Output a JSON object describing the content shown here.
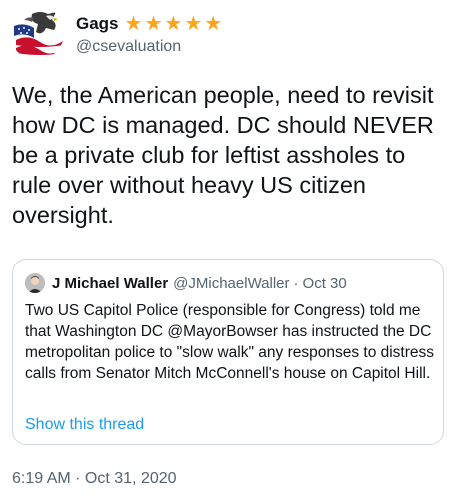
{
  "author": {
    "display_name": "Gags",
    "handle": "@csevaluation",
    "badges": [
      "★",
      "★",
      "★",
      "★",
      "★"
    ],
    "avatar_icon": "american-flag-eagle-icon"
  },
  "tweet": {
    "text": "We, the American people, need to revisit how DC is managed. DC should NEVER be a private club for leftist assholes to rule over without heavy US citizen oversight.",
    "timestamp": "6:19 AM · Oct 31, 2020"
  },
  "quoted_tweet": {
    "display_name": "J Michael Waller",
    "handle": "@JMichaelWaller",
    "separator": "·",
    "date": "Oct 30",
    "text": "Two US Capitol Police (responsible for Congress) told me that Washington DC @MayorBowser has instructed the DC metropolitan police to \"slow walk\" any responses to distress calls from Senator Mitch McConnell's house on Capitol Hill.",
    "show_thread_label": "Show this thread"
  },
  "colors": {
    "text": "#0f1419",
    "secondary": "#536471",
    "link": "#1d9bf0",
    "star": "#f6a623",
    "border": "#cfd9de"
  }
}
